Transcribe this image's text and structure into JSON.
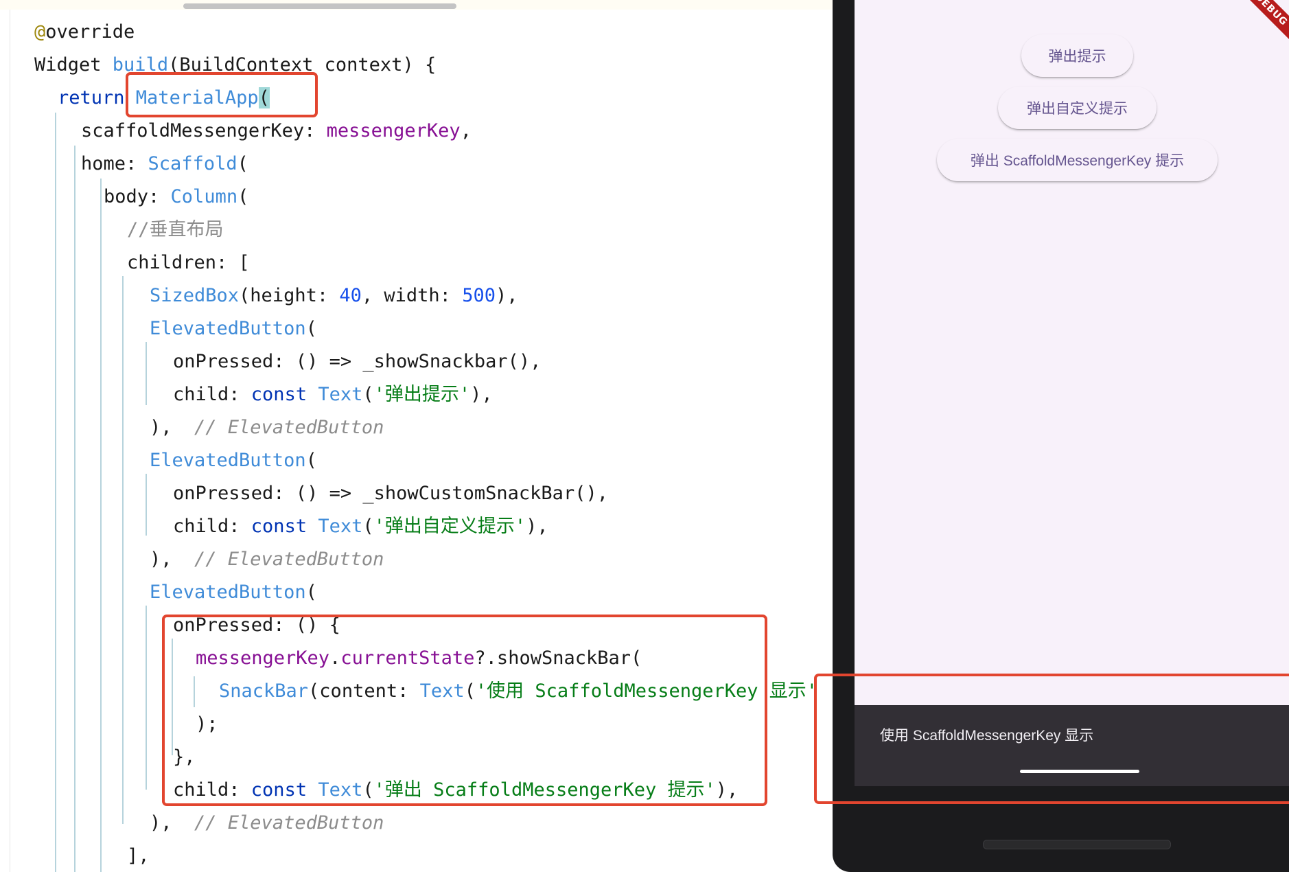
{
  "editor": {
    "lines": [
      {
        "segments": [
          {
            "cls": "an",
            "text": "@"
          },
          {
            "text": "override"
          }
        ]
      },
      {
        "segments": [
          {
            "text": "Widget "
          },
          {
            "cls": "ty",
            "text": "build"
          },
          {
            "text": "(BuildContext context) {"
          }
        ]
      },
      {
        "segments": [
          {
            "cls": "kw",
            "text": "return "
          },
          {
            "cls": "ty",
            "text": "MaterialApp"
          },
          {
            "cls": "bm",
            "text": "("
          }
        ]
      },
      {
        "segments": [
          {
            "text": "scaffoldMessengerKey: "
          },
          {
            "cls": "pu",
            "text": "messengerKey"
          },
          {
            "text": ","
          }
        ]
      },
      {
        "segments": [
          {
            "text": "home: "
          },
          {
            "cls": "ty",
            "text": "Scaffold"
          },
          {
            "text": "("
          }
        ]
      },
      {
        "segments": [
          {
            "text": "body: "
          },
          {
            "cls": "ty",
            "text": "Column"
          },
          {
            "text": "("
          }
        ]
      },
      {
        "segments": [
          {
            "cls": "cmp",
            "text": "//垂直布局"
          }
        ]
      },
      {
        "segments": [
          {
            "text": "children: ["
          }
        ]
      },
      {
        "segments": [
          {
            "cls": "ty",
            "text": "SizedBox"
          },
          {
            "text": "(height: "
          },
          {
            "cls": "nu",
            "text": "40"
          },
          {
            "text": ", width: "
          },
          {
            "cls": "nu",
            "text": "500"
          },
          {
            "text": "),"
          }
        ]
      },
      {
        "segments": [
          {
            "cls": "ty",
            "text": "ElevatedButton"
          },
          {
            "text": "("
          }
        ]
      },
      {
        "segments": [
          {
            "text": "onPressed: () => _showSnackbar(),"
          }
        ]
      },
      {
        "segments": [
          {
            "text": "child: "
          },
          {
            "cls": "kw",
            "text": "const "
          },
          {
            "cls": "ty",
            "text": "Text"
          },
          {
            "text": "("
          },
          {
            "cls": "st",
            "text": "'弹出提示'"
          },
          {
            "text": "),"
          }
        ]
      },
      {
        "segments": [
          {
            "text": "),  "
          },
          {
            "cls": "cm",
            "text": "// ElevatedButton"
          }
        ]
      },
      {
        "segments": [
          {
            "cls": "ty",
            "text": "ElevatedButton"
          },
          {
            "text": "("
          }
        ]
      },
      {
        "segments": [
          {
            "text": "onPressed: () => _showCustomSnackBar(),"
          }
        ]
      },
      {
        "segments": [
          {
            "text": "child: "
          },
          {
            "cls": "kw",
            "text": "const "
          },
          {
            "cls": "ty",
            "text": "Text"
          },
          {
            "text": "("
          },
          {
            "cls": "st",
            "text": "'弹出自定义提示'"
          },
          {
            "text": "),"
          }
        ]
      },
      {
        "segments": [
          {
            "text": "),  "
          },
          {
            "cls": "cm",
            "text": "// ElevatedButton"
          }
        ]
      },
      {
        "segments": [
          {
            "cls": "ty",
            "text": "ElevatedButton"
          },
          {
            "text": "("
          }
        ]
      },
      {
        "segments": [
          {
            "text": "onPressed: () {"
          }
        ]
      },
      {
        "segments": [
          {
            "cls": "pu",
            "text": "messengerKey"
          },
          {
            "text": "."
          },
          {
            "cls": "pu",
            "text": "currentState"
          },
          {
            "text": "?.showSnackBar("
          }
        ]
      },
      {
        "segments": [
          {
            "cls": "ty",
            "text": "SnackBar"
          },
          {
            "text": "(content: "
          },
          {
            "cls": "ty",
            "text": "Text"
          },
          {
            "text": "("
          },
          {
            "cls": "st",
            "text": "'使用 ScaffoldMessengerKey 显示'"
          }
        ]
      },
      {
        "segments": [
          {
            "text": ");"
          }
        ]
      },
      {
        "segments": [
          {
            "text": "},"
          }
        ]
      },
      {
        "segments": [
          {
            "text": "child: "
          },
          {
            "cls": "kw",
            "text": "const "
          },
          {
            "cls": "ty",
            "text": "Text"
          },
          {
            "text": "("
          },
          {
            "cls": "st",
            "text": "'弹出 ScaffoldMessengerKey 提示'"
          },
          {
            "text": "),"
          }
        ]
      },
      {
        "segments": [
          {
            "text": "),  "
          },
          {
            "cls": "cm",
            "text": "// ElevatedButton"
          }
        ]
      },
      {
        "segments": [
          {
            "text": "],"
          }
        ]
      }
    ]
  },
  "app": {
    "debug_banner": "DEBUG",
    "buttons": [
      "弹出提示",
      "弹出自定义提示",
      "弹出 ScaffoldMessengerKey 提示"
    ],
    "snackbar_text": "使用 ScaffoldMessengerKey 显示"
  },
  "colors": {
    "button_text": "#65558f",
    "screen_bg": "#f8f1fa",
    "snackbar_bg": "#322f35",
    "annotation_red": "#e2452f"
  }
}
